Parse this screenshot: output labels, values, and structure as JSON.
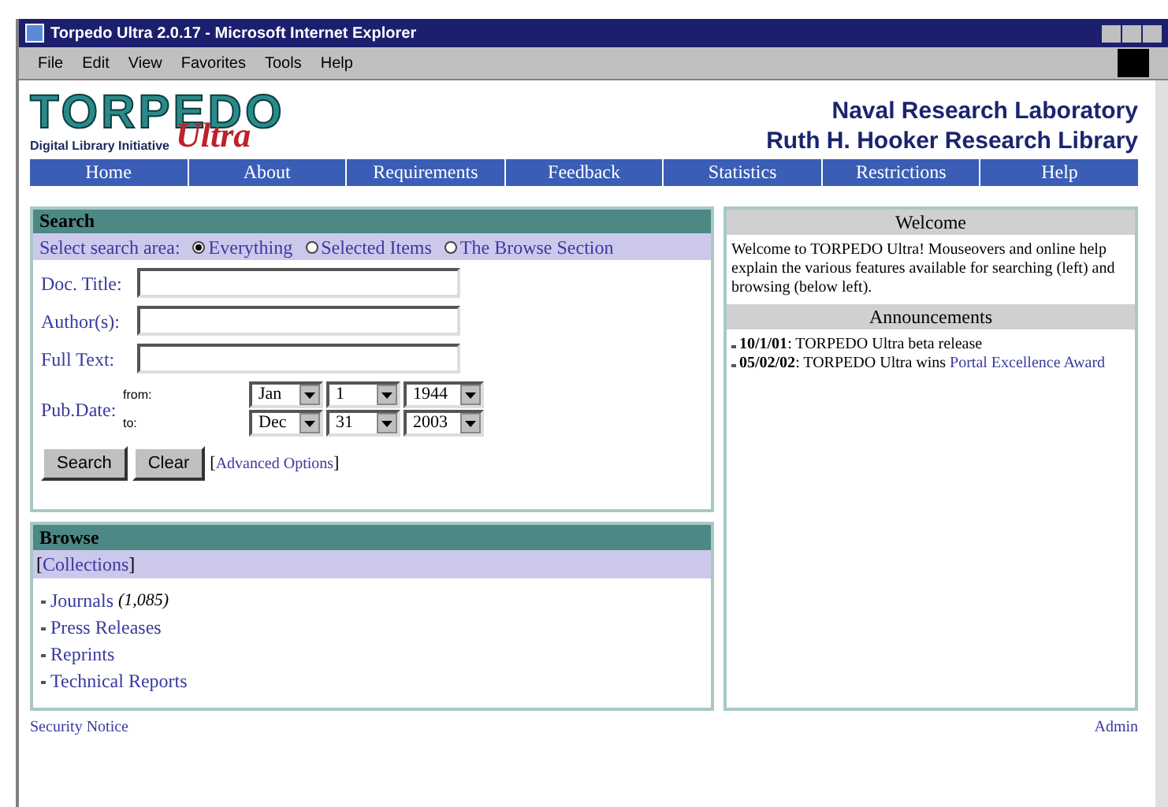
{
  "window": {
    "title": "Torpedo Ultra 2.0.17 - Microsoft Internet Explorer"
  },
  "menu": [
    "File",
    "Edit",
    "View",
    "Favorites",
    "Tools",
    "Help"
  ],
  "logo": {
    "name": "TORPEDO",
    "tagline": "Digital Library Initiative",
    "edition": "Ultra"
  },
  "org": [
    "Naval Research Laboratory",
    "Ruth H. Hooker Research Library"
  ],
  "nav": [
    "Home",
    "About",
    "Requirements",
    "Feedback",
    "Statistics",
    "Restrictions",
    "Help"
  ],
  "search": {
    "title": "Search",
    "area_label": "Select search area:",
    "areas": [
      {
        "label": "Everything",
        "selected": true
      },
      {
        "label": "Selected Items",
        "selected": false
      },
      {
        "label": "The Browse Section",
        "selected": false
      }
    ],
    "fields": [
      "Doc. Title:",
      "Author(s):",
      "Full Text:"
    ],
    "date_label": "Pub.Date:",
    "date_rows": [
      {
        "label": "from:",
        "values": [
          "Jan",
          "1",
          "1944"
        ]
      },
      {
        "label": "to:",
        "values": [
          "Dec",
          "31",
          "2003"
        ]
      }
    ],
    "buttons": [
      "Search",
      "Clear"
    ],
    "advanced": "Advanced Options",
    "brackets": [
      "[",
      "]"
    ]
  },
  "browse": {
    "title": "Browse",
    "collections": "Collections",
    "brackets": [
      "[",
      "]"
    ],
    "items": [
      {
        "label": "Journals",
        "count": "(1,085)"
      },
      {
        "label": "Press Releases"
      },
      {
        "label": "Reprints"
      },
      {
        "label": "Technical Reports"
      }
    ]
  },
  "welcome": {
    "title": "Welcome",
    "text": "Welcome to TORPEDO Ultra! Mouseovers and online help explain the various features available for searching (left) and browsing (below left)."
  },
  "announcements": {
    "title": "Announcements",
    "items": [
      {
        "text": "**10/1/01**: TORPEDO Ultra beta release"
      },
      {
        "text": "**05/02/02**: TORPEDO Ultra wins",
        "link": "Portal Excellence Award"
      }
    ]
  },
  "footer": {
    "left": "Security Notice",
    "right": "Admin"
  }
}
